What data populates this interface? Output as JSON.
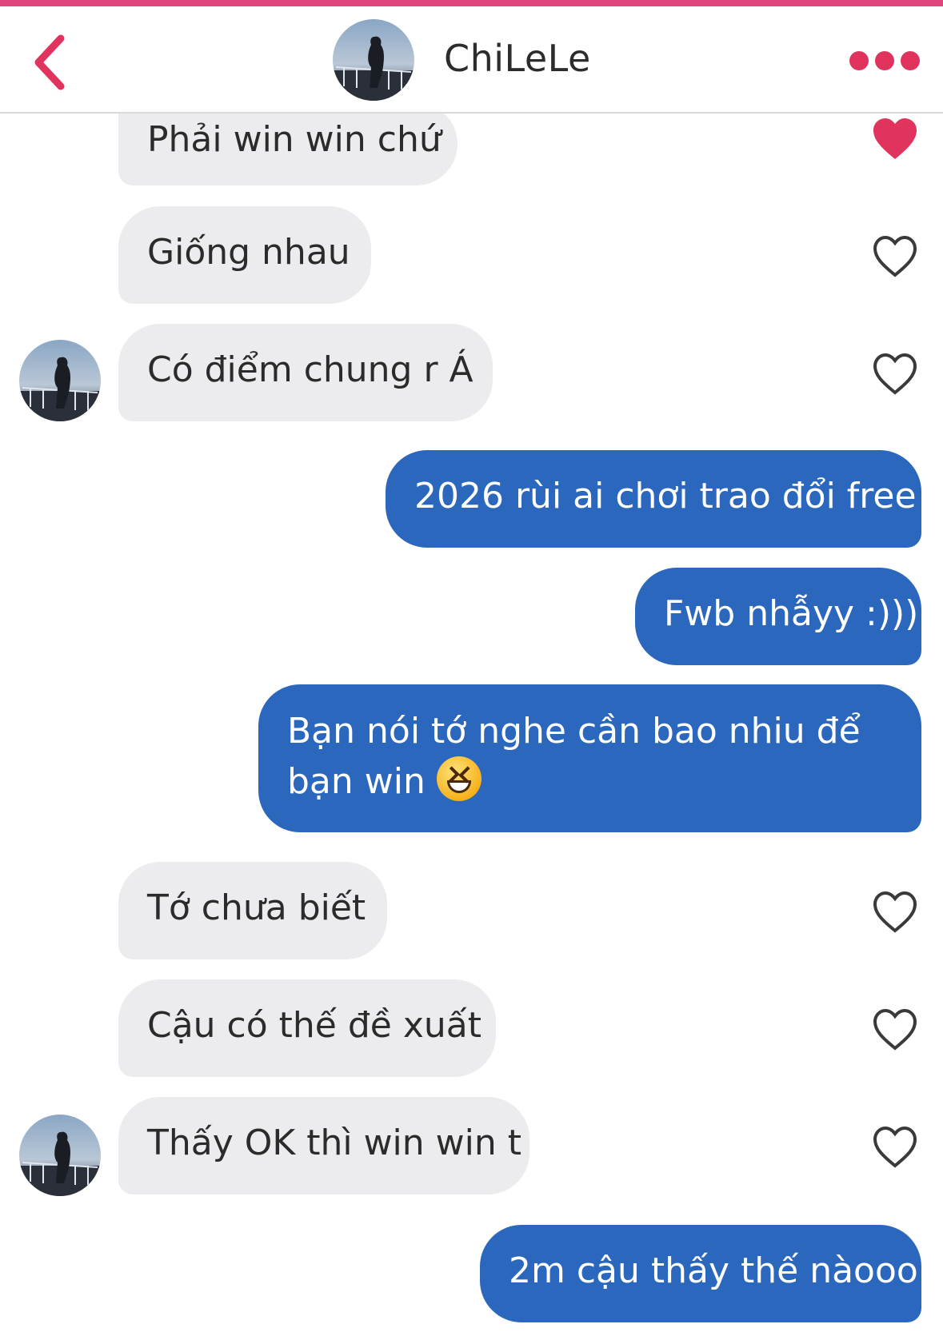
{
  "header": {
    "contact_name": "ChiLeLe",
    "accent_color": "#e0457b",
    "icons": {
      "back": "chevron-left-icon",
      "more": "more-dots-icon"
    }
  },
  "messages": [
    {
      "id": "m1",
      "direction": "incoming",
      "text": "Phải win win chứ",
      "liked": true
    },
    {
      "id": "m2",
      "direction": "incoming",
      "text": "Giống nhau",
      "liked": false
    },
    {
      "id": "m3",
      "direction": "incoming",
      "text": "Có điểm chung r Á",
      "liked": false,
      "avatar": true
    },
    {
      "id": "m4",
      "direction": "outgoing",
      "text": "2026 rùi ai chơi trao đổi free"
    },
    {
      "id": "m5",
      "direction": "outgoing",
      "text": "Fwb nhẫyy :)))"
    },
    {
      "id": "m6",
      "direction": "outgoing",
      "text_line1": "Bạn nói tớ nghe cần bao nhiu để",
      "text_line2": "bạn win",
      "emoji": "grinning-squinting-face"
    },
    {
      "id": "m7",
      "direction": "incoming",
      "text": "Tớ chưa biết",
      "liked": false
    },
    {
      "id": "m8",
      "direction": "incoming",
      "text": "Cậu có thế đề xuất",
      "liked": false
    },
    {
      "id": "m9",
      "direction": "incoming",
      "text": "Thấy OK thì win win t",
      "liked": false,
      "avatar": true
    },
    {
      "id": "m10",
      "direction": "outgoing",
      "text": "2m cậu thấy thế nàooo"
    }
  ],
  "colors": {
    "incoming_bubble": "#ececef",
    "outgoing_bubble": "#2b67bd",
    "heart_active": "#e0335d",
    "heart_inactive": "#3a3a3a"
  }
}
